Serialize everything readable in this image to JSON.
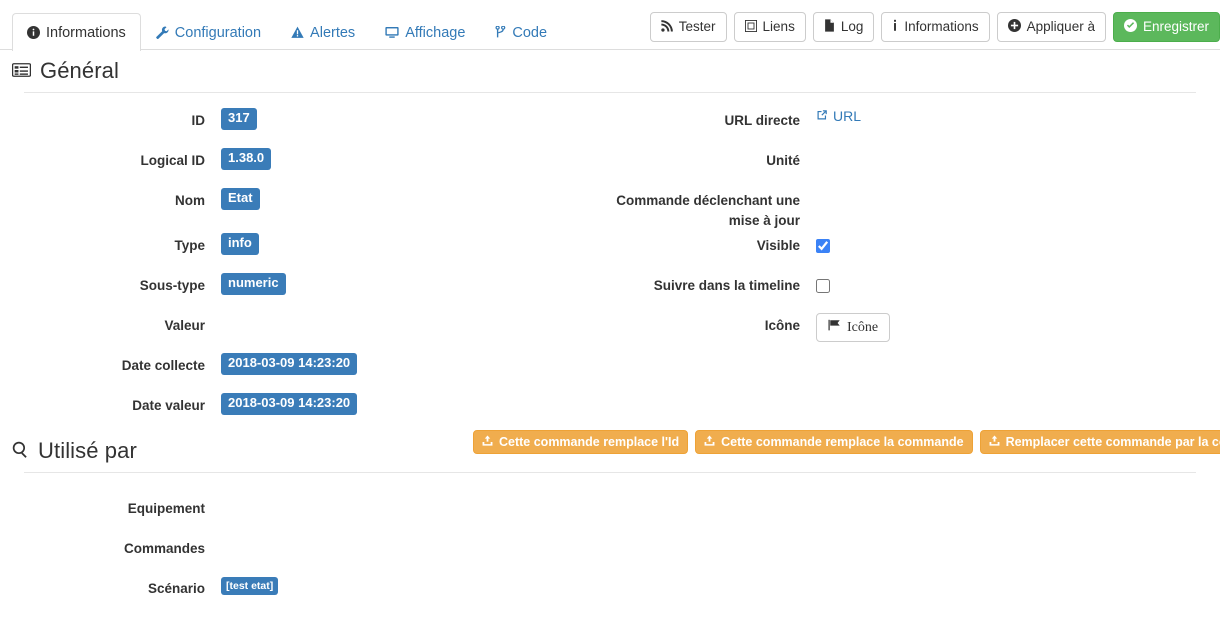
{
  "tabs": [
    {
      "label": "Informations",
      "icon": "info-circle-icon",
      "active": true
    },
    {
      "label": "Configuration",
      "icon": "wrench-icon",
      "active": false
    },
    {
      "label": "Alertes",
      "icon": "warning-triangle-icon",
      "active": false
    },
    {
      "label": "Affichage",
      "icon": "desktop-icon",
      "active": false
    },
    {
      "label": "Code",
      "icon": "code-branch-icon",
      "active": false
    }
  ],
  "toolbar": {
    "buttons": [
      {
        "label": "Tester",
        "icon": "rss-icon",
        "style": "default"
      },
      {
        "label": "Liens",
        "icon": "sitemap-icon",
        "style": "default"
      },
      {
        "label": "Log",
        "icon": "file-icon",
        "style": "default"
      },
      {
        "label": "Informations",
        "icon": "info-icon",
        "style": "default"
      },
      {
        "label": "Appliquer à",
        "icon": "plus-circle-icon",
        "style": "default"
      },
      {
        "label": "Enregistrer",
        "icon": "check-circle-icon",
        "style": "success"
      }
    ]
  },
  "general": {
    "title": "Général",
    "icon": "list-alt-icon",
    "left": [
      {
        "label": "ID",
        "value": "317",
        "type": "badge"
      },
      {
        "label": "Logical ID",
        "value": "1.38.0",
        "type": "badge"
      },
      {
        "label": "Nom",
        "value": "Etat",
        "type": "badge"
      },
      {
        "label": "Type",
        "value": "info",
        "type": "badge"
      },
      {
        "label": "Sous-type",
        "value": "numeric",
        "type": "badge"
      },
      {
        "label": "Valeur",
        "value": "",
        "type": "empty"
      },
      {
        "label": "Date collecte",
        "value": "2018-03-09 14:23:20",
        "type": "badge"
      },
      {
        "label": "Date valeur",
        "value": "2018-03-09 14:23:20",
        "type": "badge"
      }
    ],
    "right": {
      "url_directe_label": "URL directe",
      "url_directe_link": "URL",
      "url_directe_icon": "external-link-icon",
      "unite_label": "Unité",
      "unite_value": "",
      "commande_label": "Commande déclenchant une mise à jour",
      "commande_value": "",
      "visible_label": "Visible",
      "visible_checked": true,
      "timeline_label": "Suivre dans la timeline",
      "timeline_checked": false,
      "icone_label": "Icône",
      "icone_button_label": "Icône",
      "icone_button_icon": "flag-icon"
    }
  },
  "usedby": {
    "title": "Utilisé par",
    "icon": "search-icon",
    "actions": [
      {
        "label": "Cette commande remplace l'Id",
        "icon": "upload-icon"
      },
      {
        "label": "Cette commande remplace la commande",
        "icon": "upload-icon"
      },
      {
        "label": "Remplacer cette commande par la commande",
        "icon": "upload-icon"
      }
    ],
    "rows": [
      {
        "label": "Equipement",
        "value": "",
        "type": "empty"
      },
      {
        "label": "Commandes",
        "value": "",
        "type": "empty"
      },
      {
        "label": "Scénario",
        "value": "[test etat]",
        "type": "badge-sm"
      }
    ]
  },
  "colors": {
    "badge_blue": "#3a7cb8",
    "link_blue": "#337ab7",
    "success_green": "#5cb85c",
    "warning_orange": "#f0ad4e",
    "checkbox_blue": "#3b82f6"
  }
}
